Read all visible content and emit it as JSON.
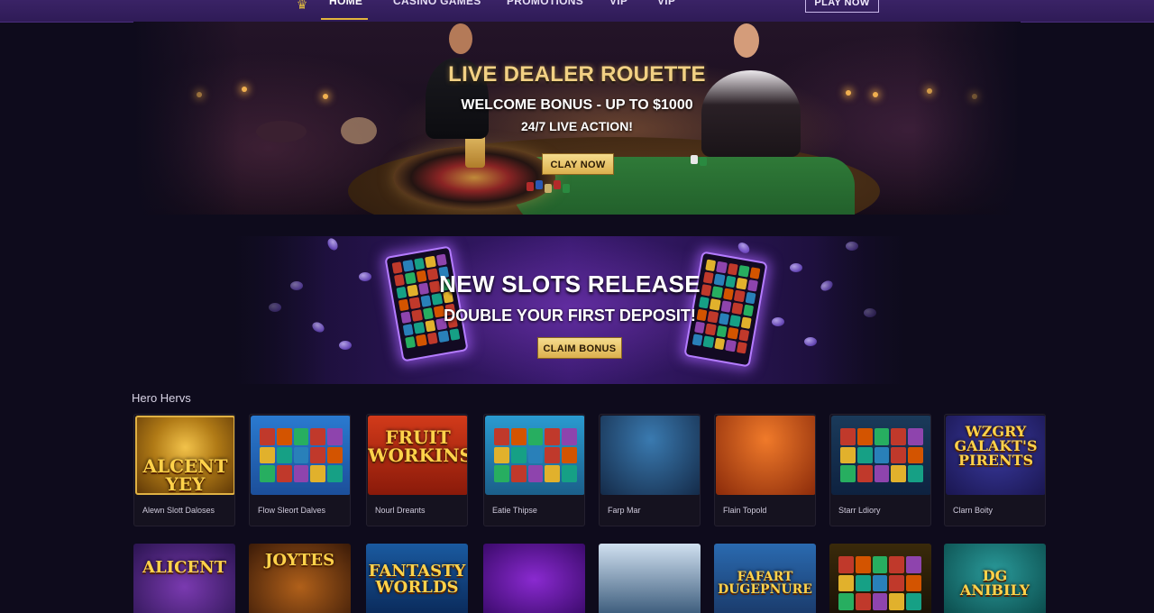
{
  "nav": {
    "items": [
      "HOME",
      "CASINO GAMES",
      "PROMOTIONS",
      "VIP",
      "VIP"
    ],
    "active": "HOME",
    "cta_label": "PLAY NOW"
  },
  "hero_live": {
    "title": "LIVE DEALER ROUETTE",
    "subtitle": "WELCOME BONUS - UP TO $1000",
    "tagline": "24/7 LIVE ACTION!",
    "cta_label": "CLAY NOW"
  },
  "hero_slots": {
    "title": "NEW SLOTS RELEASE",
    "subtitle": "DOUBLE YOUR FIRST DEPOSIT!",
    "cta_label": "CLAIM BONUS"
  },
  "section": {
    "title": "Hero Hervs"
  },
  "games_row1": [
    {
      "name": "Alewn Slott Daloses",
      "art": "ALCENT\nYEY"
    },
    {
      "name": "Flow Sleort Dalves",
      "art": ""
    },
    {
      "name": "Nourl Dreants",
      "art": "FRUIT\nWORKINS"
    },
    {
      "name": "Eatie Thipse",
      "art": ""
    },
    {
      "name": "Farp Mar",
      "art": ""
    },
    {
      "name": "Flain Topold",
      "art": ""
    },
    {
      "name": "Starr Ldiory",
      "art": ""
    },
    {
      "name": "Clarn Boity",
      "art": "WZGRY\nGALAKT'S\nPIRENTS"
    }
  ],
  "games_row2": [
    {
      "art": "ALICENT"
    },
    {
      "art": "JOYTES"
    },
    {
      "art": "FANTASTY\nWORLDS"
    },
    {
      "art": ""
    },
    {
      "art": ""
    },
    {
      "art": "FAFART\nDUGEPNURE"
    },
    {
      "art": ""
    },
    {
      "art": "DG\nANIBILY"
    }
  ],
  "colors": {
    "nav_bg": "#3a2366",
    "accent_gold": "#e2b53c",
    "page_bg": "#0e0b1c"
  }
}
